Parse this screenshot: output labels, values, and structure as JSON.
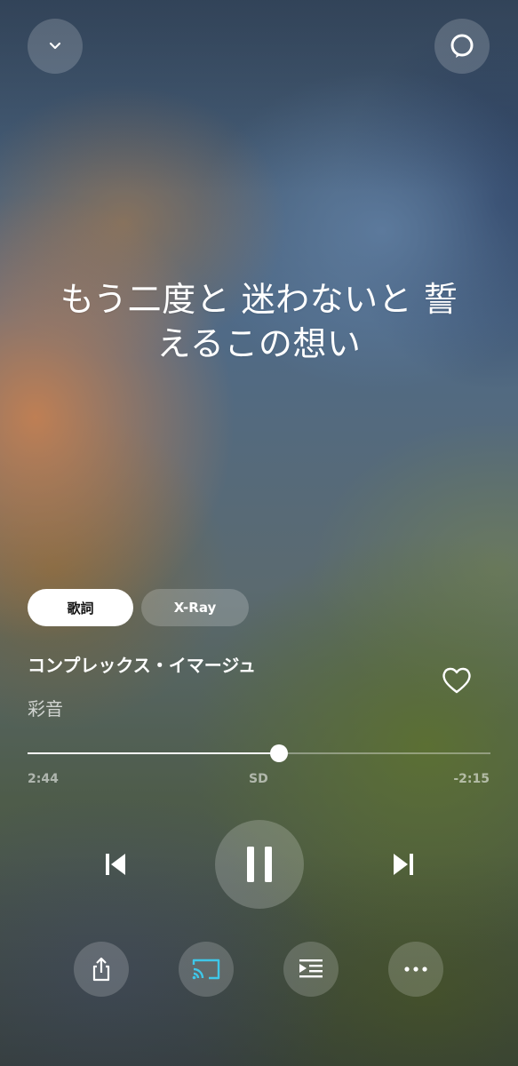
{
  "lyrics": {
    "line1": "もう二度と 迷わないと 誓",
    "line2": "えるこの想い"
  },
  "tabs": {
    "lyrics_label": "歌詞",
    "xray_label": "X-Ray"
  },
  "track": {
    "title": "コンプレックス・イマージュ",
    "artist": "彩音"
  },
  "playback": {
    "elapsed": "2:44",
    "quality": "SD",
    "remaining": "-2:15",
    "progress_fraction": 0.543
  },
  "icons": {
    "collapse": "chevron-down-icon",
    "alexa": "alexa-ring-icon",
    "favorite": "heart-icon",
    "previous": "skip-previous-icon",
    "pause": "pause-icon",
    "next": "skip-next-icon",
    "share": "share-icon",
    "cast": "cast-icon",
    "queue": "queue-icon",
    "more": "more-icon"
  },
  "colors": {
    "cast_accent": "#3fc7e8"
  }
}
